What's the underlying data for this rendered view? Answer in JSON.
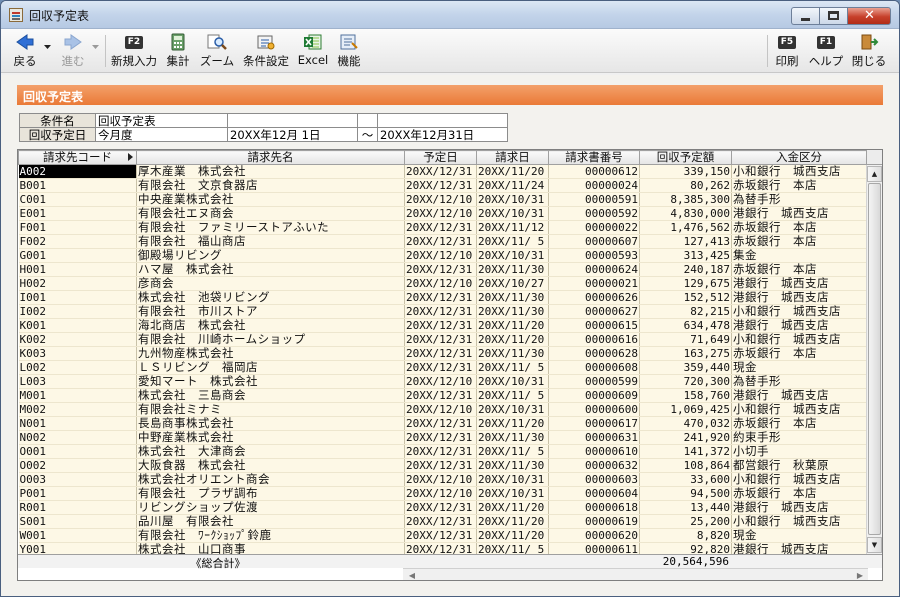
{
  "window": {
    "title": "回収予定表"
  },
  "toolbar": {
    "back": "戻る",
    "forward": "進む",
    "new": "新規入力",
    "aggregate": "集計",
    "zoom": "ズーム",
    "conditions": "条件設定",
    "excel": "Excel",
    "functions": "機能",
    "print": "印刷",
    "help": "ヘルプ",
    "close": "閉じる",
    "f2": "F2",
    "f5": "F5",
    "f1": "F1"
  },
  "section_title": "回収予定表",
  "conditions": {
    "name_label": "条件名",
    "name_value": "回収予定表",
    "date_label": "回収予定日",
    "date_value": "今月度",
    "date_from": "20XX年12月 1日",
    "tilde": "〜",
    "date_to": "20XX年12月31日"
  },
  "table": {
    "headers": [
      "請求先コード",
      "請求先名",
      "予定日",
      "請求日",
      "請求書番号",
      "回収予定額",
      "入金区分"
    ],
    "rows": [
      [
        "A002",
        "厚木産業　株式会社",
        "20XX/12/31",
        "20XX/11/20",
        "00000612",
        "339,150",
        "小和銀行　城西支店"
      ],
      [
        "B001",
        "有限会社　文京食器店",
        "20XX/12/31",
        "20XX/11/24",
        "00000024",
        "80,262",
        "赤坂銀行　本店"
      ],
      [
        "C001",
        "中央産業株式会社",
        "20XX/12/10",
        "20XX/10/31",
        "00000591",
        "8,385,300",
        "為替手形"
      ],
      [
        "E001",
        "有限会社エヌ商会",
        "20XX/12/10",
        "20XX/10/31",
        "00000592",
        "4,830,000",
        "港銀行　城西支店"
      ],
      [
        "F001",
        "有限会社　ファミリーストアふいた",
        "20XX/12/31",
        "20XX/11/12",
        "00000022",
        "1,476,562",
        "赤坂銀行　本店"
      ],
      [
        "F002",
        "有限会社　福山商店",
        "20XX/12/31",
        "20XX/11/ 5",
        "00000607",
        "127,413",
        "赤坂銀行　本店"
      ],
      [
        "G001",
        "御殿場リビング",
        "20XX/12/10",
        "20XX/10/31",
        "00000593",
        "313,425",
        "集金"
      ],
      [
        "H001",
        "ハマ屋　株式会社",
        "20XX/12/31",
        "20XX/11/30",
        "00000624",
        "240,187",
        "赤坂銀行　本店"
      ],
      [
        "H002",
        "彦商会",
        "20XX/12/10",
        "20XX/10/27",
        "00000021",
        "129,675",
        "港銀行　城西支店"
      ],
      [
        "I001",
        "株式会社　池袋リビング",
        "20XX/12/31",
        "20XX/11/30",
        "00000626",
        "152,512",
        "港銀行　城西支店"
      ],
      [
        "I002",
        "有限会社　市川ストア",
        "20XX/12/31",
        "20XX/11/30",
        "00000627",
        "82,215",
        "小和銀行　城西支店"
      ],
      [
        "K001",
        "海北商店　株式会社",
        "20XX/12/31",
        "20XX/11/20",
        "00000615",
        "634,478",
        "港銀行　城西支店"
      ],
      [
        "K002",
        "有限会社　川崎ホームショップ",
        "20XX/12/31",
        "20XX/11/20",
        "00000616",
        "71,649",
        "小和銀行　城西支店"
      ],
      [
        "K003",
        "九州物産株式会社",
        "20XX/12/31",
        "20XX/11/30",
        "00000628",
        "163,275",
        "赤坂銀行　本店"
      ],
      [
        "L002",
        "ＬＳリビング　福岡店",
        "20XX/12/31",
        "20XX/11/ 5",
        "00000608",
        "359,440",
        "現金"
      ],
      [
        "L003",
        "愛知マート　株式会社",
        "20XX/12/10",
        "20XX/10/31",
        "00000599",
        "720,300",
        "為替手形"
      ],
      [
        "M001",
        "株式会社　三島商会",
        "20XX/12/31",
        "20XX/11/ 5",
        "00000609",
        "158,760",
        "港銀行　城西支店"
      ],
      [
        "M002",
        "有限会社ミナミ",
        "20XX/12/10",
        "20XX/10/31",
        "00000600",
        "1,069,425",
        "小和銀行　城西支店"
      ],
      [
        "N001",
        "長島商事株式会社",
        "20XX/12/31",
        "20XX/11/20",
        "00000617",
        "470,032",
        "赤坂銀行　本店"
      ],
      [
        "N002",
        "中野産業株式会社",
        "20XX/12/31",
        "20XX/11/30",
        "00000631",
        "241,920",
        "約束手形"
      ],
      [
        "O001",
        "株式会社　大津商会",
        "20XX/12/31",
        "20XX/11/ 5",
        "00000610",
        "141,372",
        "小切手"
      ],
      [
        "O002",
        "大阪食器　株式会社",
        "20XX/12/31",
        "20XX/11/30",
        "00000632",
        "108,864",
        "都営銀行　秋葉原"
      ],
      [
        "O003",
        "株式会社オリエント商会",
        "20XX/12/10",
        "20XX/10/31",
        "00000603",
        "33,600",
        "小和銀行　城西支店"
      ],
      [
        "P001",
        "有限会社　プラザ調布",
        "20XX/12/10",
        "20XX/10/31",
        "00000604",
        "94,500",
        "赤坂銀行　本店"
      ],
      [
        "R001",
        "リビングショップ佐渡",
        "20XX/12/31",
        "20XX/11/20",
        "00000618",
        "13,440",
        "港銀行　城西支店"
      ],
      [
        "S001",
        "品川屋　有限会社",
        "20XX/12/31",
        "20XX/11/20",
        "00000619",
        "25,200",
        "小和銀行　城西支店"
      ],
      [
        "W001",
        "有限会社　ﾜｰｸｼｮｯﾌﾟ鈴鹿",
        "20XX/12/31",
        "20XX/11/20",
        "00000620",
        "8,820",
        "現金"
      ],
      [
        "Y001",
        "株式会社　山口商事",
        "20XX/12/31",
        "20XX/11/ 5",
        "00000611",
        "92,820",
        "港銀行　城西支店"
      ]
    ]
  },
  "total": {
    "label": "《総合計》",
    "value": "20,564,596"
  }
}
